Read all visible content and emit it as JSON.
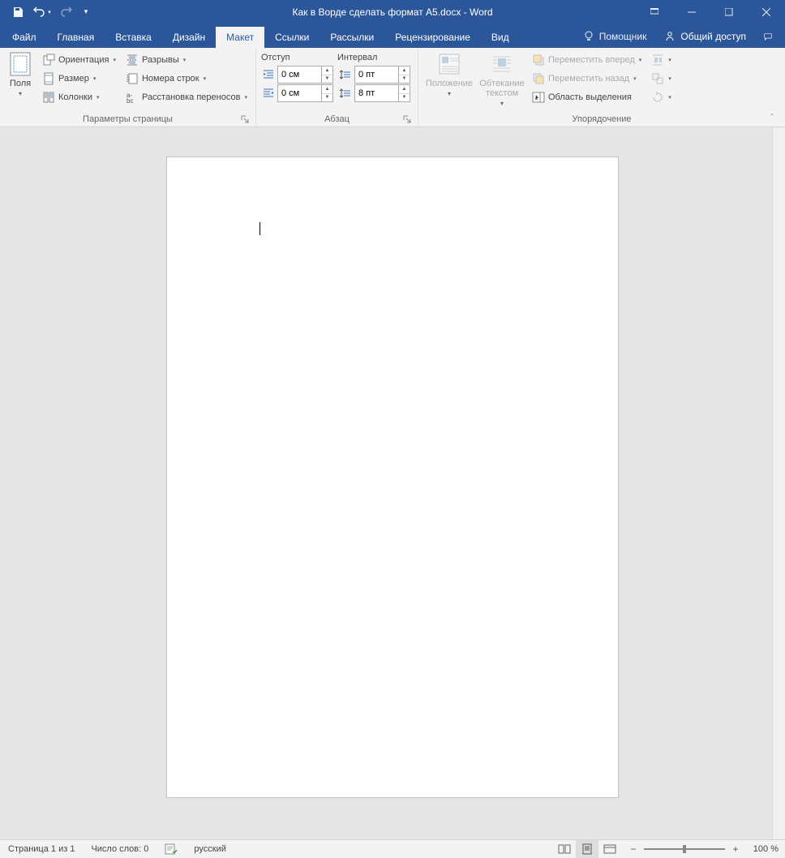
{
  "title": "Как в Ворде сделать формат А5.docx - Word",
  "tabs": [
    "Файл",
    "Главная",
    "Вставка",
    "Дизайн",
    "Макет",
    "Ссылки",
    "Рассылки",
    "Рецензирование",
    "Вид"
  ],
  "active_tab": 4,
  "tell_me": "Помощник",
  "share": "Общий доступ",
  "ribbon": {
    "page_setup": {
      "margins": "Поля",
      "orientation": "Ориентация",
      "size": "Размер",
      "columns": "Колонки",
      "breaks": "Разрывы",
      "line_numbers": "Номера строк",
      "hyphenation": "Расстановка переносов",
      "label": "Параметры страницы"
    },
    "paragraph": {
      "indent_label": "Отступ",
      "spacing_label": "Интервал",
      "indent_left": "0 см",
      "indent_right": "0 см",
      "space_before": "0 пт",
      "space_after": "8 пт",
      "label": "Абзац"
    },
    "arrange": {
      "position": "Положение",
      "wrap": "Обтекание текстом",
      "bring_forward": "Переместить вперед",
      "send_backward": "Переместить назад",
      "selection_pane": "Область выделения",
      "label": "Упорядочение"
    }
  },
  "status": {
    "page": "Страница 1 из 1",
    "words": "Число слов: 0",
    "language": "русский",
    "zoom": "100 %"
  }
}
